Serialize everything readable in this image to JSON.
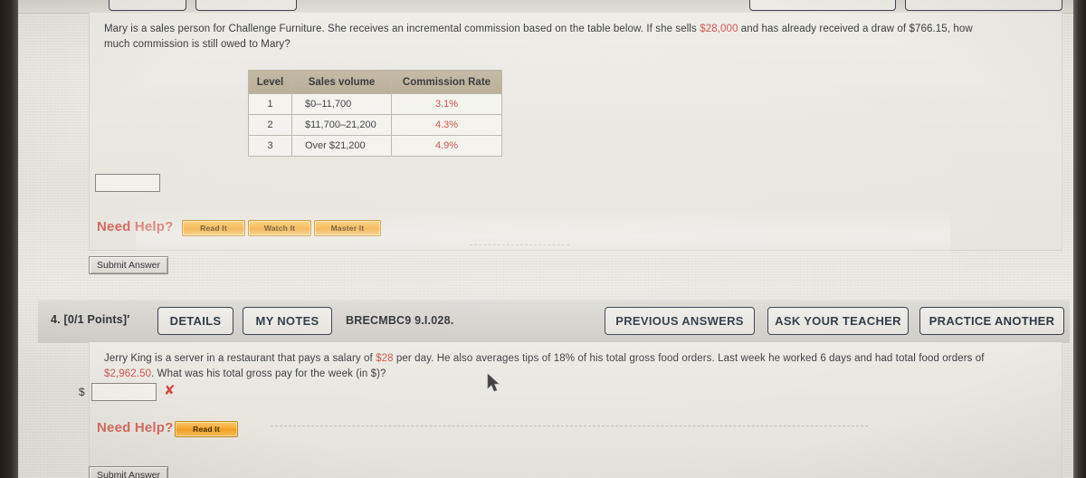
{
  "page": {
    "background_color": "#e8e5df",
    "edge_color": "#241f1b"
  },
  "question_3": {
    "prompt_line_1": "Mary is a sales person for Challenge Furniture. She receives an incremental commission based on the table below. If she sells ",
    "prompt_highlight_1": "$28,000",
    "prompt_line_1b": " and has already received a draw of $766.15, how",
    "prompt_line_2": "much commission is still owed to Mary?",
    "answer_value": "",
    "need_help_label": "Need Help?",
    "help_buttons": [
      {
        "label": "Read It",
        "name": "read-it-button"
      },
      {
        "label": "Watch It",
        "name": "watch-it-button"
      },
      {
        "label": "Master It",
        "name": "master-it-button"
      }
    ],
    "submit_label": "Submit Answer",
    "table": {
      "headers": [
        "Level",
        "Sales volume",
        "Commission Rate"
      ],
      "rows": [
        {
          "level": "1",
          "volume": "$0–11,700",
          "rate": "3.1%"
        },
        {
          "level": "2",
          "volume": "$11,700–21,200",
          "rate": "4.3%"
        },
        {
          "level": "3",
          "volume": "Over $21,200",
          "rate": "4.9%"
        }
      ],
      "header_bg": "#bcb199",
      "rate_color": "#c94f48"
    }
  },
  "question_4": {
    "number_points": "4. [0/1 Points]′",
    "details_label": "DETAILS",
    "my_notes_label": "MY NOTES",
    "code": "BRECMBC9 9.I.028.",
    "previous_answers_label": "PREVIOUS ANSWERS",
    "ask_teacher_label": "ASK YOUR TEACHER",
    "practice_another_label": "PRACTICE ANOTHER",
    "prompt_line_1a": "Jerry King is a server in a restaurant that pays a salary of ",
    "prompt_highlight_1": "$28",
    "prompt_line_1b": " per day. He also averages tips of ",
    "prompt_highlight_2": "18%",
    "prompt_line_1c": " of his total gross food orders. Last week he worked 6 days and had total food orders of",
    "prompt_highlight_3": "$2,962.50",
    "prompt_line_2b": ". What was his total gross pay for the week (in $)?",
    "currency_symbol": "$",
    "answer_value": "",
    "answer_status_icon": "incorrect-x-icon",
    "answer_status_color": "#cf4b46",
    "need_help_label": "Need Help?",
    "help_buttons": [
      {
        "label": "Read It",
        "name": "read-it-button"
      }
    ],
    "submit_label": "Submit Answer"
  }
}
